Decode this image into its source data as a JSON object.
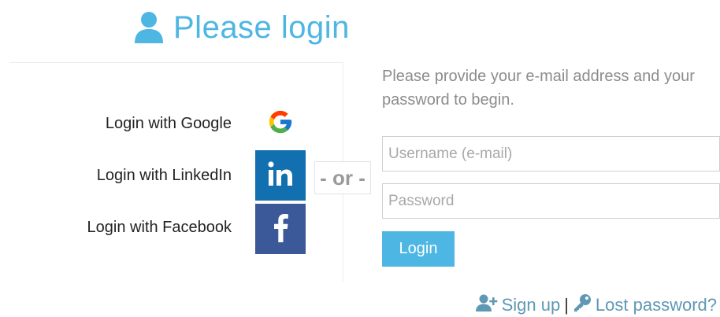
{
  "header": {
    "title": "Please login",
    "user_icon": "user-icon",
    "accent_color": "#4db6e3"
  },
  "social": {
    "google_label": "Login with Google",
    "linkedin_label": "Login with LinkedIn",
    "facebook_label": "Login with Facebook",
    "google_icon": "google-logo-icon",
    "linkedin_icon": "linkedin-logo-icon",
    "facebook_icon": "facebook-logo-icon",
    "linkedin_color": "#1270b0",
    "facebook_color": "#3b5998"
  },
  "divider": {
    "or_text": "- or -"
  },
  "form": {
    "intro": "Please provide your e-mail address and your password to begin.",
    "username_placeholder": "Username (e-mail)",
    "password_placeholder": "Password",
    "login_label": "Login"
  },
  "footer": {
    "signup_label": "Sign up",
    "separator": "|",
    "lost_password_label": "Lost password?",
    "signup_icon": "user-plus-icon",
    "lost_password_icon": "key-icon"
  }
}
